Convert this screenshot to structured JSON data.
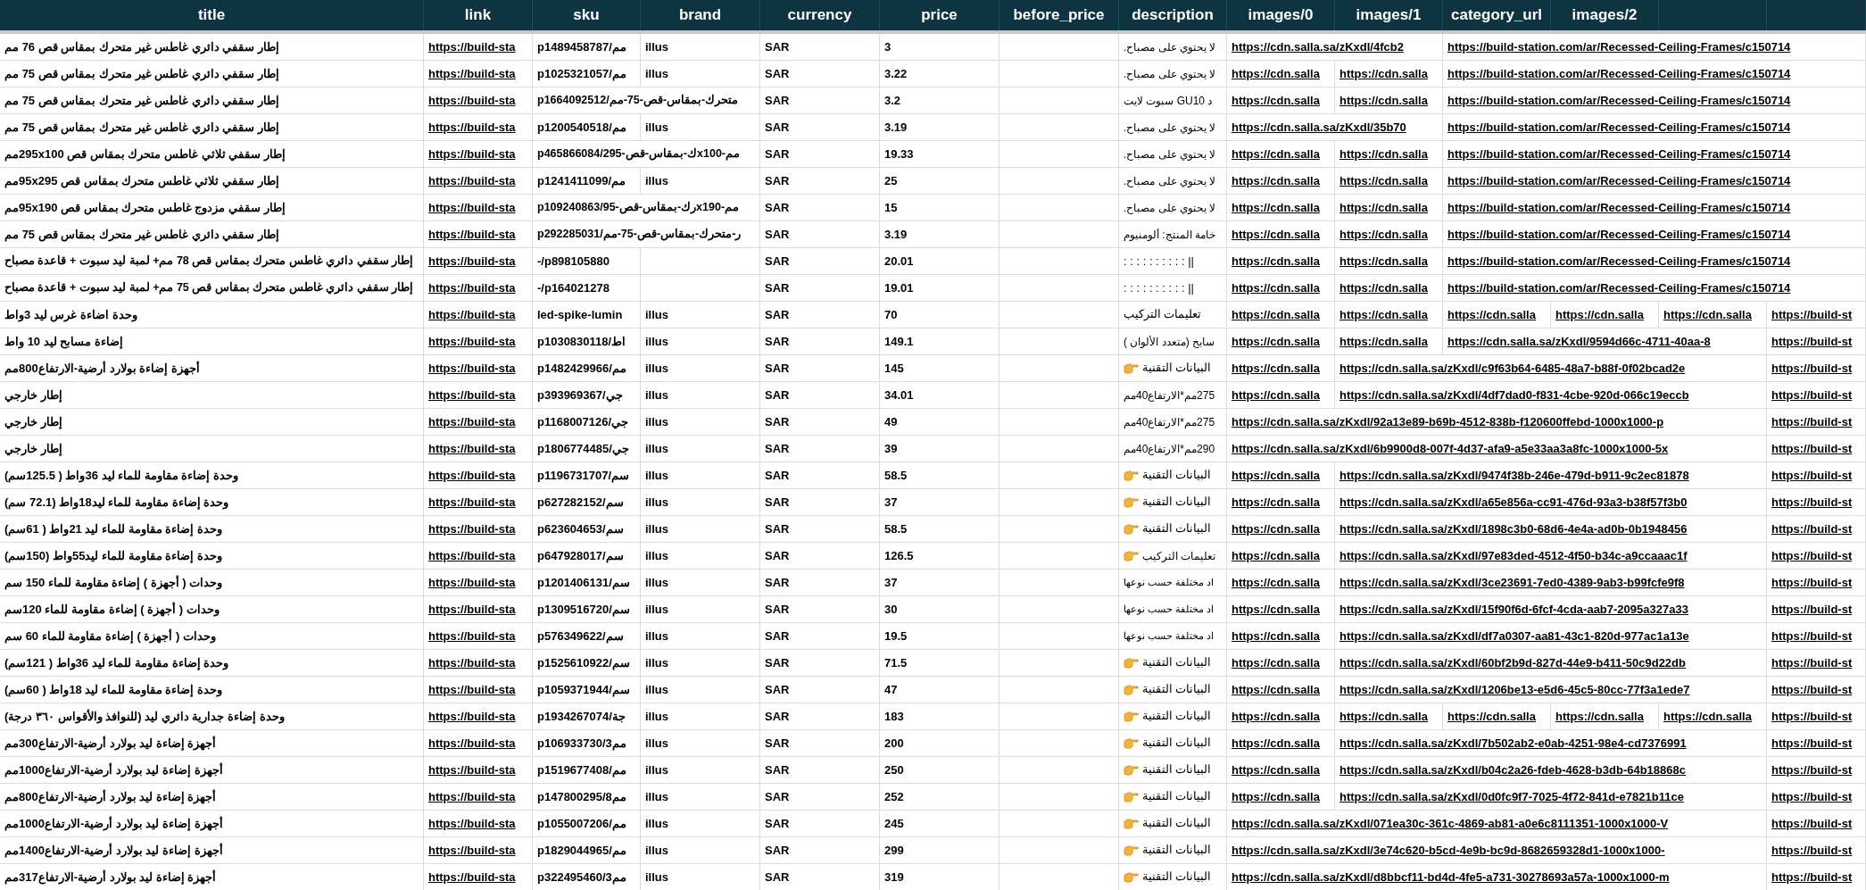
{
  "table": {
    "columns": [
      "title",
      "link",
      "sku",
      "brand",
      "currency",
      "price",
      "before_price",
      "description",
      "images/0",
      "images/1",
      "category_url",
      "images/2"
    ],
    "rows": [
      {
        "title": "إطار سقفي دائري غاطس غير متحرك بمقاس قص 76 مم",
        "link": "https://build-sta",
        "sku": "p1489458787/مم",
        "brand": "illus",
        "currency": "SAR",
        "price": "3",
        "description": {
          "text": "لا يحتوي على مصباح.",
          "pointer_icon": false
        },
        "images_0": "https://cdn.salla.sa/zKxdl/4fcb2",
        "category_url": "https://build-station.com/ar/Recessed-Ceiling-Frames/c150714"
      },
      {
        "title": "إطار سقفي دائري غاطس غير متحرك بمقاس قص 75 مم",
        "link": "https://build-sta",
        "sku": "p1025321057/مم",
        "brand": "illus",
        "currency": "SAR",
        "price": "3.22",
        "description": {
          "text": "لا يحتوي على مصباح.",
          "pointer_icon": false
        },
        "images_0": "https://cdn.salla",
        "images_1": "https://cdn.salla",
        "category_url": "https://build-station.com/ar/Recessed-Ceiling-Frames/c150714"
      },
      {
        "title": "إطار سقفي دائري غاطس غير متحرك بمقاس قص 75 مم",
        "link": "https://build-sta",
        "sku": "p1664092512/متحرك-بمقاس-قص-75-مم",
        "currency": "SAR",
        "price": "3.2",
        "description": {
          "text": "د GU10 سبوت لايت",
          "pointer_icon": false
        },
        "images_0": "https://cdn.salla",
        "images_1": "https://cdn.salla",
        "category_url": "https://build-station.com/ar/Recessed-Ceiling-Frames/c150714"
      },
      {
        "title": "إطار سقفي دائري غاطس غير متحرك بمقاس قص 75 مم",
        "link": "https://build-sta",
        "sku": "p1200540518/مم",
        "brand": "illus",
        "currency": "SAR",
        "price": "3.19",
        "description": {
          "text": "لا يحتوي على مصباح.",
          "pointer_icon": false
        },
        "images_0": "https://cdn.salla.sa/zKxdl/35b70",
        "category_url": "https://build-station.com/ar/Recessed-Ceiling-Frames/c150714"
      },
      {
        "title": "إطار سقفي ثلاثي غاطس متحرك بمقاس قص 295x100مم",
        "link": "https://build-sta",
        "sku": "p465866084/ك-بمقاس-قص-295x100-مم",
        "currency": "SAR",
        "price": "19.33",
        "description": {
          "text": "لا يحتوي على مصباح.",
          "pointer_icon": false
        },
        "images_0": "https://cdn.salla",
        "images_1": "https://cdn.salla",
        "category_url": "https://build-station.com/ar/Recessed-Ceiling-Frames/c150714"
      },
      {
        "title": "إطار سقفي ثلاثي غاطس متحرك بمقاس قص 95x295مم",
        "link": "https://build-sta",
        "sku": "p1241411099/مم",
        "brand": "illus",
        "currency": "SAR",
        "price": "25",
        "description": {
          "text": "لا يحتوي على مصباح.",
          "pointer_icon": false
        },
        "images_0": "https://cdn.salla",
        "images_1": "https://cdn.salla",
        "category_url": "https://build-station.com/ar/Recessed-Ceiling-Frames/c150714"
      },
      {
        "title": "إطار سقفي مزدوج غاطس متحرك بمقاس قص 95x190مم",
        "link": "https://build-sta",
        "sku": "p109240863/رك-بمقاس-قص-95x190-مم",
        "currency": "SAR",
        "price": "15",
        "description": {
          "text": "لا يحتوي على مصباح.",
          "pointer_icon": false
        },
        "images_0": "https://cdn.salla",
        "images_1": "https://cdn.salla",
        "category_url": "https://build-station.com/ar/Recessed-Ceiling-Frames/c150714"
      },
      {
        "title": "إطار سقفي دائري غاطس غير متحرك بمقاس قص 75 مم",
        "link": "https://build-sta",
        "sku": "p292285031/ر-متحرك-بمقاس-قص-75-مم",
        "currency": "SAR",
        "price": "3.19",
        "description": {
          "text": "خامة المنتج: ألومنيوم",
          "pointer_icon": false
        },
        "images_0": "https://cdn.salla",
        "images_1": "https://cdn.salla",
        "category_url": "https://build-station.com/ar/Recessed-Ceiling-Frames/c150714"
      },
      {
        "title": "إطار سقفي دائري غاطس متحرك بمقاس قص 78 مم+ لمبة ليد سبوت + قاعدة مصباح",
        "link": "https://build-sta",
        "sku": "-/p898105880",
        "currency": "SAR",
        "price": "20.01",
        "description": {
          "text": "|| : : : : : : : : : :",
          "pointer_icon": false
        },
        "images_0": "https://cdn.salla",
        "images_1": "https://cdn.salla",
        "category_url": "https://build-station.com/ar/Recessed-Ceiling-Frames/c150714"
      },
      {
        "title": "إطار سقفي دائري غاطس متحرك بمقاس قص 75 مم+ لمبة ليد سبوت + قاعدة مصباح",
        "link": "https://build-sta",
        "sku": "-/p164021278",
        "currency": "SAR",
        "price": "19.01",
        "description": {
          "text": "|| : : : : : : : : : :",
          "pointer_icon": false
        },
        "images_0": "https://cdn.salla",
        "images_1": "https://cdn.salla",
        "category_url": "https://build-station.com/ar/Recessed-Ceiling-Frames/c150714"
      },
      {
        "title": "وحدة اضاءة غرس ليد 3واط",
        "link": "https://build-sta",
        "sku": "led-spike-lumin",
        "brand": "illus",
        "currency": "SAR",
        "price": "70",
        "description": {
          "text": "تعليمات التركيب",
          "pointer_icon": false
        },
        "images_0": "https://cdn.salla",
        "images_1": "https://cdn.salla",
        "category_url": "https://cdn.salla",
        "images_2": "https://cdn.salla",
        "column_13": "https://cdn.salla",
        "column_14": "https://build-st"
      },
      {
        "title": "إضاءة مسابح ليد 10 واط",
        "link": "https://build-sta",
        "sku": "p1030830118/اط",
        "brand": "illus",
        "currency": "SAR",
        "price": "149.1",
        "description": {
          "text": "سابح (متعدد الألوان )",
          "pointer_icon": false
        },
        "images_0": "https://cdn.salla",
        "images_1": "https://cdn.salla",
        "category_url": "https://cdn.salla.sa/zKxdl/9594d66c-4711-40aa-8",
        "column_14": "https://build-st"
      },
      {
        "title": "أجهزة إضاءة بولارد أرضية-الارتفاع800مم",
        "link": "https://build-sta",
        "sku": "p1482429966/مم",
        "brand": "illus",
        "currency": "SAR",
        "price": "145",
        "description": {
          "text": "البيانات التقنية",
          "pointer_icon": true
        },
        "images_0": "https://cdn.salla",
        "images_1": "https://cdn.salla.sa/zKxdl/c9f63b64-6485-48a7-b88f-0f02bcad2e",
        "column_14": "https://build-st"
      },
      {
        "title": "إطار خارجي",
        "link": "https://build-sta",
        "sku": "p393969367/جي",
        "brand": "illus",
        "currency": "SAR",
        "price": "34.01",
        "description": {
          "text": "275مم*الارتفاع40مم",
          "pointer_icon": false
        },
        "images_0": "https://cdn.salla",
        "images_1": "https://cdn.salla.sa/zKxdl/4df7dad0-f831-4cbe-920d-066c19eccb",
        "column_14": "https://build-st"
      },
      {
        "title": "إطار خارجي",
        "link": "https://build-sta",
        "sku": "p1168007126/جي",
        "brand": "illus",
        "currency": "SAR",
        "price": "49",
        "description": {
          "text": "275مم*الارتفاع40مم",
          "pointer_icon": false
        },
        "images_0": "https://cdn.salla.sa/zKxdl/92a13e89-b69b-4512-838b-f120600ffebd-1000x1000-p",
        "column_14": "https://build-st"
      },
      {
        "title": "إطار خارجي",
        "link": "https://build-sta",
        "sku": "p1806774485/جي",
        "brand": "illus",
        "currency": "SAR",
        "price": "39",
        "description": {
          "text": "290مم*الارتفاع40مم",
          "pointer_icon": false
        },
        "images_0": "https://cdn.salla.sa/zKxdl/6b9900d8-007f-4d37-afa9-a5e33aa3a8fc-1000x1000-5x",
        "column_14": "https://build-st"
      },
      {
        "title": "وحدة إضاءة مقاومة للماء ليد 36واط ( 125.5سم)",
        "link": "https://build-sta",
        "sku": "p1196731707/سم",
        "brand": "illus",
        "currency": "SAR",
        "price": "58.5",
        "description": {
          "text": "البيانات التقنية",
          "pointer_icon": true
        },
        "images_0": "https://cdn.salla",
        "images_1": "https://cdn.salla.sa/zKxdl/9474f38b-246e-479d-b911-9c2ec81878",
        "column_14": "https://build-st"
      },
      {
        "title": "وحدة إضاءة مقاومة للماء ليد18واط (72.1 سم)",
        "link": "https://build-sta",
        "sku": "p627282152/سم",
        "brand": "illus",
        "currency": "SAR",
        "price": "37",
        "description": {
          "text": "البيانات التقنية",
          "pointer_icon": true
        },
        "images_0": "https://cdn.salla",
        "images_1": "https://cdn.salla.sa/zKxdl/a65e856a-cc91-476d-93a3-b38f57f3b0",
        "column_14": "https://build-st"
      },
      {
        "title": "وحدة إضاءة مقاومة للماء ليد 21واط ( 61سم)",
        "link": "https://build-sta",
        "sku": "p623604653/سم",
        "brand": "illus",
        "currency": "SAR",
        "price": "58.5",
        "description": {
          "text": "البيانات التقنية",
          "pointer_icon": true
        },
        "images_0": "https://cdn.salla",
        "images_1": "https://cdn.salla.sa/zKxdl/1898c3b0-68d6-4e4a-ad0b-0b1948456",
        "column_14": "https://build-st"
      },
      {
        "title": "وحدة إضاءة مقاومة للماء ليد55واط (150سم)",
        "link": "https://build-sta",
        "sku": "p647928017/سم",
        "brand": "illus",
        "currency": "SAR",
        "price": "126.5",
        "description": {
          "text": "تعليمات التركيب",
          "pointer_icon": true
        },
        "images_0": "https://cdn.salla",
        "images_1": "https://cdn.salla.sa/zKxdl/97e83ded-4512-4f50-b34c-a9ccaaac1f",
        "column_14": "https://build-st"
      },
      {
        "title": "وحدات ( أجهزة ) إضاءة مقاومة للماء 150 سم",
        "link": "https://build-sta",
        "sku": "p1201406131/سم",
        "brand": "illus",
        "currency": "SAR",
        "price": "37",
        "description": {
          "text": "اد مختلفة حسب نوعها",
          "pointer_icon": false
        },
        "images_0": "https://cdn.salla",
        "images_1": "https://cdn.salla.sa/zKxdl/3ce23691-7ed0-4389-9ab3-b99fcfe9f8",
        "column_14": "https://build-st"
      },
      {
        "title": "وحدات ( أجهزة ) إضاءة مقاومة للماء 120سم",
        "link": "https://build-sta",
        "sku": "p1309516720/سم",
        "brand": "illus",
        "currency": "SAR",
        "price": "30",
        "description": {
          "text": "اد مختلفة حسب نوعها",
          "pointer_icon": false
        },
        "images_0": "https://cdn.salla",
        "images_1": "https://cdn.salla.sa/zKxdl/15f90f6d-6fcf-4cda-aab7-2095a327a33",
        "column_14": "https://build-st"
      },
      {
        "title": "وحدات ( أجهزة ) إضاءة مقاومة للماء 60 سم",
        "link": "https://build-sta",
        "sku": "p576349622/سم",
        "brand": "illus",
        "currency": "SAR",
        "price": "19.5",
        "description": {
          "text": "اد مختلفة حسب نوعها",
          "pointer_icon": false
        },
        "images_0": "https://cdn.salla",
        "images_1": "https://cdn.salla.sa/zKxdl/df7a0307-aa81-43c1-820d-977ac1a13e",
        "column_14": "https://build-st"
      },
      {
        "title": "وحدة إضاءة مقاومة للماء ليد 36واط ( 121سم)",
        "link": "https://build-sta",
        "sku": "p1525610922/سم",
        "brand": "illus",
        "currency": "SAR",
        "price": "71.5",
        "description": {
          "text": "البيانات التقنية",
          "pointer_icon": true
        },
        "images_0": "https://cdn.salla",
        "images_1": "https://cdn.salla.sa/zKxdl/60bf2b9d-827d-44e9-b411-50c9d22db",
        "column_14": "https://build-st"
      },
      {
        "title": "وحدة إضاءة مقاومة للماء ليد 18واط ( 60سم)",
        "link": "https://build-sta",
        "sku": "p1059371944/سم",
        "brand": "illus",
        "currency": "SAR",
        "price": "47",
        "description": {
          "text": "البيانات التقنية",
          "pointer_icon": true
        },
        "images_0": "https://cdn.salla",
        "images_1": "https://cdn.salla.sa/zKxdl/1206be13-e5d6-45c5-80cc-77f3a1ede7",
        "column_14": "https://build-st"
      },
      {
        "title": "وحدة إضاءة جدارية دائري ليد (للنوافذ والأقواس ٣٦٠ درجة)",
        "link": "https://build-sta",
        "sku": "p1934267074/جة",
        "brand": "illus",
        "currency": "SAR",
        "price": "183",
        "description": {
          "text": "البيانات التقنية",
          "pointer_icon": true
        },
        "images_0": "https://cdn.salla",
        "images_1": "https://cdn.salla",
        "category_url": "https://cdn.salla",
        "images_2": "https://cdn.salla",
        "column_13": "https://cdn.salla",
        "column_14": "https://build-st"
      },
      {
        "title": "أجهزة إضاءة ليد بولارد أرضية-الارتفاع300مم",
        "link": "https://build-sta",
        "sku": "p106933730/3مم",
        "brand": "illus",
        "currency": "SAR",
        "price": "200",
        "description": {
          "text": "البيانات التقنية",
          "pointer_icon": true
        },
        "images_0": "https://cdn.salla",
        "images_1": "https://cdn.salla.sa/zKxdl/7b502ab2-e0ab-4251-98e4-cd7376991",
        "column_14": "https://build-st"
      },
      {
        "title": "أجهزة إضاءة ليد بولارد أرضية-الارتفاع1000مم",
        "link": "https://build-sta",
        "sku": "p1519677408/مم",
        "brand": "illus",
        "currency": "SAR",
        "price": "250",
        "description": {
          "text": "البيانات التقنية",
          "pointer_icon": true
        },
        "images_0": "https://cdn.salla",
        "images_1": "https://cdn.salla.sa/zKxdl/b04c2a26-fdeb-4628-b3db-64b18868c",
        "column_14": "https://build-st"
      },
      {
        "title": "أجهزة إضاءة ليد بولارد أرضية-الارتفاع800مم",
        "link": "https://build-sta",
        "sku": "p147800295/8مم",
        "brand": "illus",
        "currency": "SAR",
        "price": "252",
        "description": {
          "text": "البيانات التقنية",
          "pointer_icon": true
        },
        "images_0": "https://cdn.salla",
        "images_1": "https://cdn.salla.sa/zKxdl/0d0fc9f7-7025-4f72-841d-e7821b11ce",
        "column_14": "https://build-st"
      },
      {
        "title": "أجهزة إضاءة ليد بولارد أرضية-الارتفاع1000مم",
        "link": "https://build-sta",
        "sku": "p1055007206/مم",
        "brand": "illus",
        "currency": "SAR",
        "price": "245",
        "description": {
          "text": "البيانات التقنية",
          "pointer_icon": true
        },
        "images_0": "https://cdn.salla.sa/zKxdl/071ea30c-361c-4869-ab81-a0e6c8111351-1000x1000-V",
        "column_14": "https://build-st"
      },
      {
        "title": "أجهزة إضاءة ليد بولارد أرضية-الارتفاع1400مم",
        "link": "https://build-sta",
        "sku": "p1829044965/مم",
        "brand": "illus",
        "currency": "SAR",
        "price": "299",
        "description": {
          "text": "البيانات التقنية",
          "pointer_icon": true
        },
        "images_0": "https://cdn.salla.sa/zKxdl/3e74c620-b5cd-4e9b-bc9d-8682659328d1-1000x1000-",
        "column_14": "https://build-st"
      },
      {
        "title": "أجهزة إضاءة ليد بولارد أرضية-الارتفاع317مم",
        "link": "https://build-sta",
        "sku": "p322495460/3مم",
        "brand": "illus",
        "currency": "SAR",
        "price": "319",
        "description": {
          "text": "البيانات التقنية",
          "pointer_icon": true
        },
        "images_0": "https://cdn.salla.sa/zKxdl/d8bbcf11-bd4d-4fe5-a731-30278693a57a-1000x1000-m",
        "column_14": "https://build-st"
      }
    ]
  }
}
